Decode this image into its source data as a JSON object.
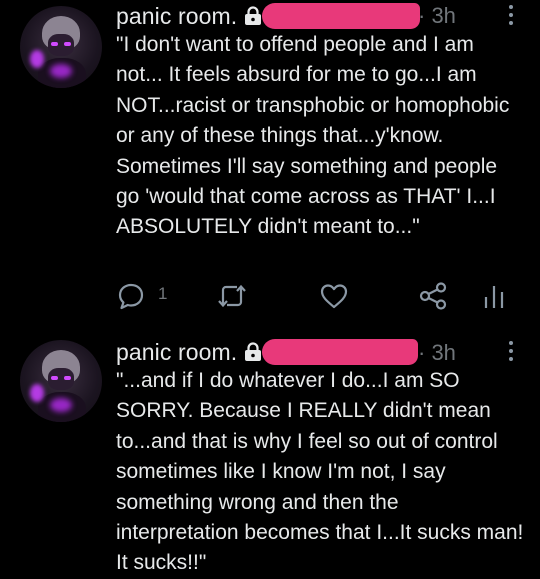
{
  "tweets": [
    {
      "author": "panic room.",
      "time": "· 3h",
      "text": "\"I don't want to offend people and I am not... It feels absurd for me to go...I am NOT...racist or transphobic or homophobic or any of these things that...y'know. Sometimes I'll say something and people go 'would that come across as THAT' I...I ABSOLUTELY didn't meant to...\"",
      "reply_count": "1",
      "icons": [
        "lock-icon",
        "more-icon",
        "reply-icon",
        "retweet-icon",
        "like-icon",
        "share-icon",
        "analytics-icon"
      ]
    },
    {
      "author": "panic room.",
      "time": "· 3h",
      "text": "\"...and if I do whatever I do...I am SO SORRY. Because I REALLY didn't mean to...and that is why I feel so out of control sometimes like I know I'm not, I say something wrong and then the interpretation becomes that I...It sucks man! It sucks!!\"",
      "icons": [
        "lock-icon",
        "more-icon"
      ]
    }
  ],
  "colors": {
    "background": "#000000",
    "text": "#e7e9ea",
    "muted": "#71767b",
    "redaction": "#e8397a",
    "avatar_accent": "#b43be3"
  }
}
